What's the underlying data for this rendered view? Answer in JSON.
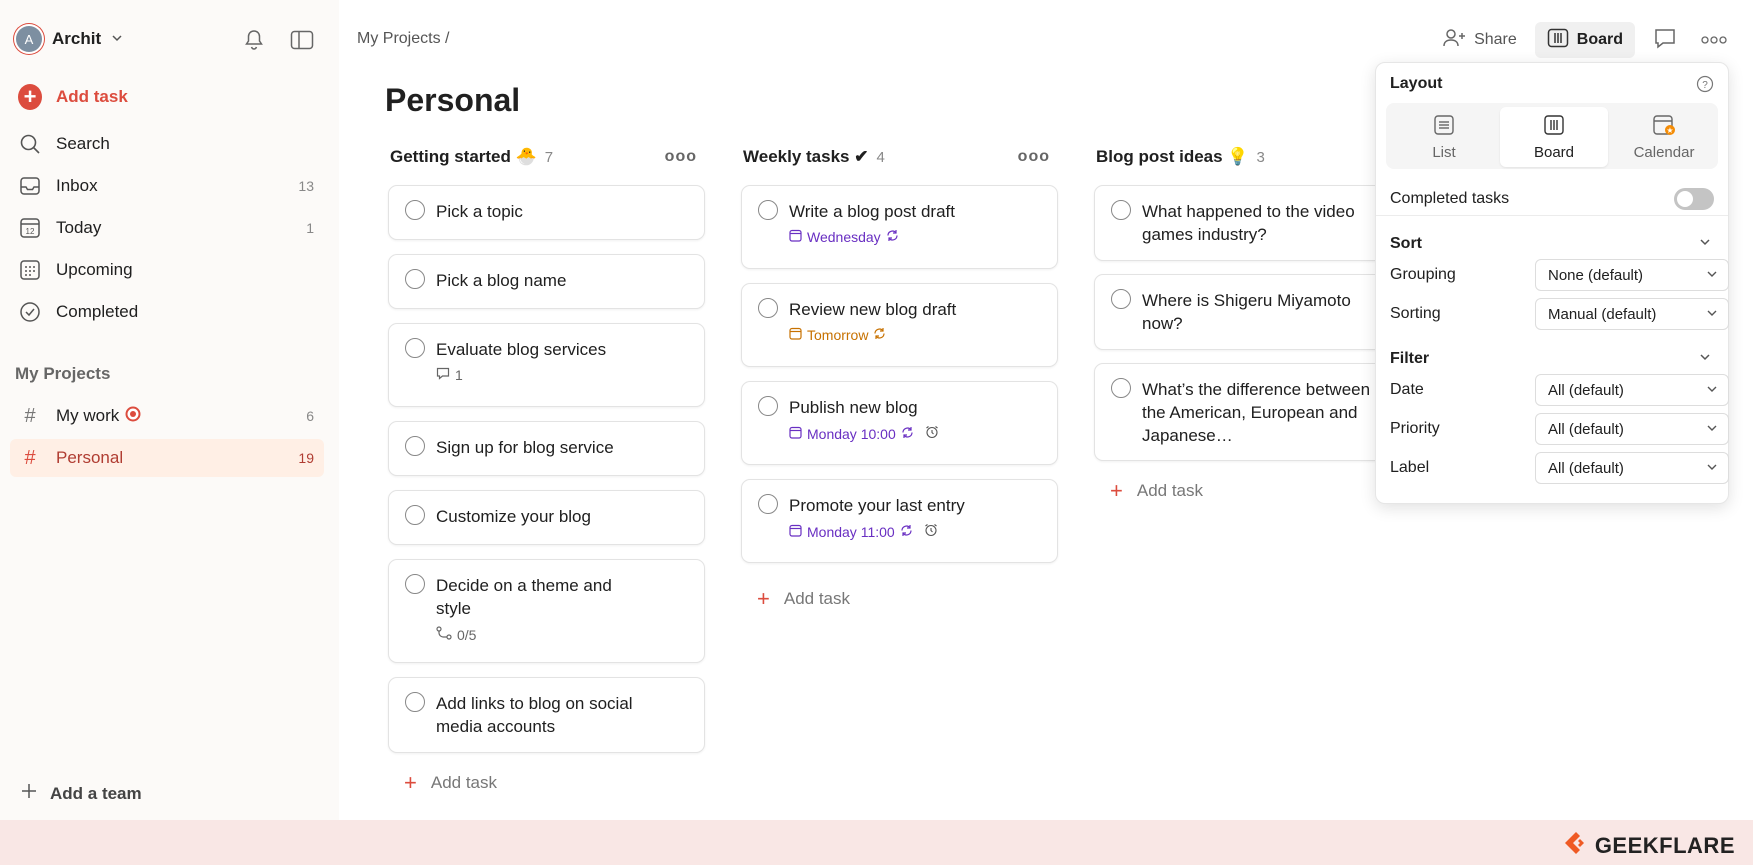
{
  "sidebar": {
    "user_name": "Archit",
    "avatar_initial": "A",
    "add_task": "Add task",
    "nav": [
      {
        "label": "Search",
        "count": ""
      },
      {
        "label": "Inbox",
        "count": "13"
      },
      {
        "label": "Today",
        "count": "1"
      },
      {
        "label": "Upcoming",
        "count": ""
      },
      {
        "label": "Completed",
        "count": ""
      }
    ],
    "today_day": "12",
    "projects_heading": "My Projects",
    "projects": [
      {
        "label": "My work",
        "count": "6"
      },
      {
        "label": "Personal",
        "count": "19"
      }
    ],
    "add_team": "Add a team"
  },
  "header": {
    "breadcrumb": "My Projects /",
    "share": "Share",
    "board": "Board",
    "page_title": "Personal"
  },
  "columns": [
    {
      "title": "Getting started 🐣",
      "count": "7",
      "tasks": [
        {
          "title": "Pick a topic"
        },
        {
          "title": "Pick a blog name"
        },
        {
          "title": "Evaluate blog services",
          "meta": "1"
        },
        {
          "title": "Sign up for blog service"
        },
        {
          "title": "Customize your blog"
        },
        {
          "title": "Decide on a theme and style",
          "meta": "0/5"
        },
        {
          "title": "Add links to blog on social media accounts"
        }
      ],
      "add_task": "Add task"
    },
    {
      "title": "Weekly tasks ✔",
      "count": "4",
      "tasks": [
        {
          "title": "Write a blog post draft",
          "meta": "Wednesday"
        },
        {
          "title": "Review new blog draft",
          "meta": "Tomorrow"
        },
        {
          "title": "Publish new blog",
          "meta": "Monday 10:00"
        },
        {
          "title": "Promote your last entry",
          "meta": "Monday 11:00"
        }
      ],
      "add_task": "Add task"
    },
    {
      "title": "Blog post ideas 💡",
      "count": "3",
      "tasks": [
        {
          "title": "What happened to the video games industry?"
        },
        {
          "title": "Where is Shigeru Miyamoto now?"
        },
        {
          "title": "What’s the difference between the American, European and Japanese…"
        }
      ],
      "add_task": "Add task"
    }
  ],
  "popover": {
    "layout_label": "Layout",
    "options": [
      "List",
      "Board",
      "Calendar"
    ],
    "completed_tasks": "Completed tasks",
    "sort_label": "Sort",
    "grouping_label": "Grouping",
    "grouping_value": "None (default)",
    "sorting_label": "Sorting",
    "sorting_value": "Manual (default)",
    "filter_label": "Filter",
    "date_label": "Date",
    "date_value": "All (default)",
    "priority_label": "Priority",
    "priority_value": "All (default)",
    "label_label": "Label",
    "label_value": "All (default)"
  },
  "footer": {
    "brand": "GEEKFLARE"
  },
  "colors": {
    "accent": "#dc4c3e",
    "date_purple": "#692fc2",
    "date_orange": "#c77100"
  }
}
